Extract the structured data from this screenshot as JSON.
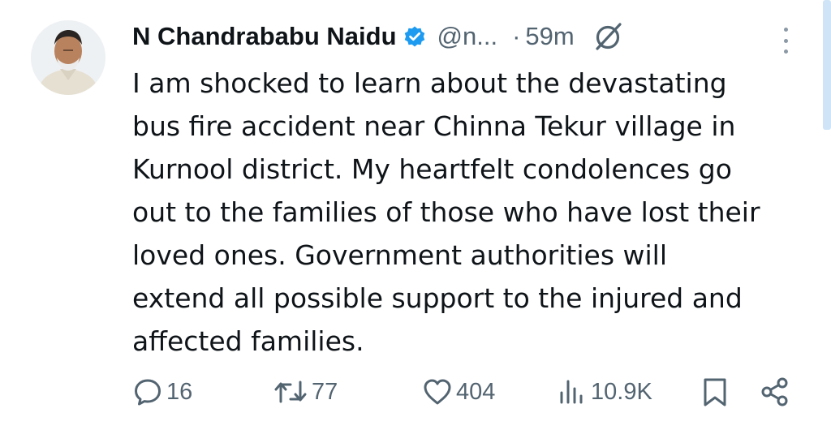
{
  "tweet": {
    "author_name": "N Chandrababu Naidu",
    "handle": "@n...",
    "separator": "·",
    "time": "59m",
    "text": "I am shocked to learn about the devastating\nbus fire accident near Chinna Tekur village in\nKurnool district. My heartfelt condolences go\nout to the families of those who have lost their\nloved ones. Government authorities will\nextend all possible support to the injured and\naffected families.",
    "verified_color": "#1d9bf0",
    "icons": {
      "verified": "verified-badge-icon",
      "grok": "grok-icon",
      "more": "more-options-icon"
    }
  },
  "actions": {
    "replies": "16",
    "reposts": "77",
    "likes": "404",
    "views": "10.9K"
  },
  "colors": {
    "text": "#0f1419",
    "muted": "#536471",
    "accent": "#1d9bf0"
  }
}
